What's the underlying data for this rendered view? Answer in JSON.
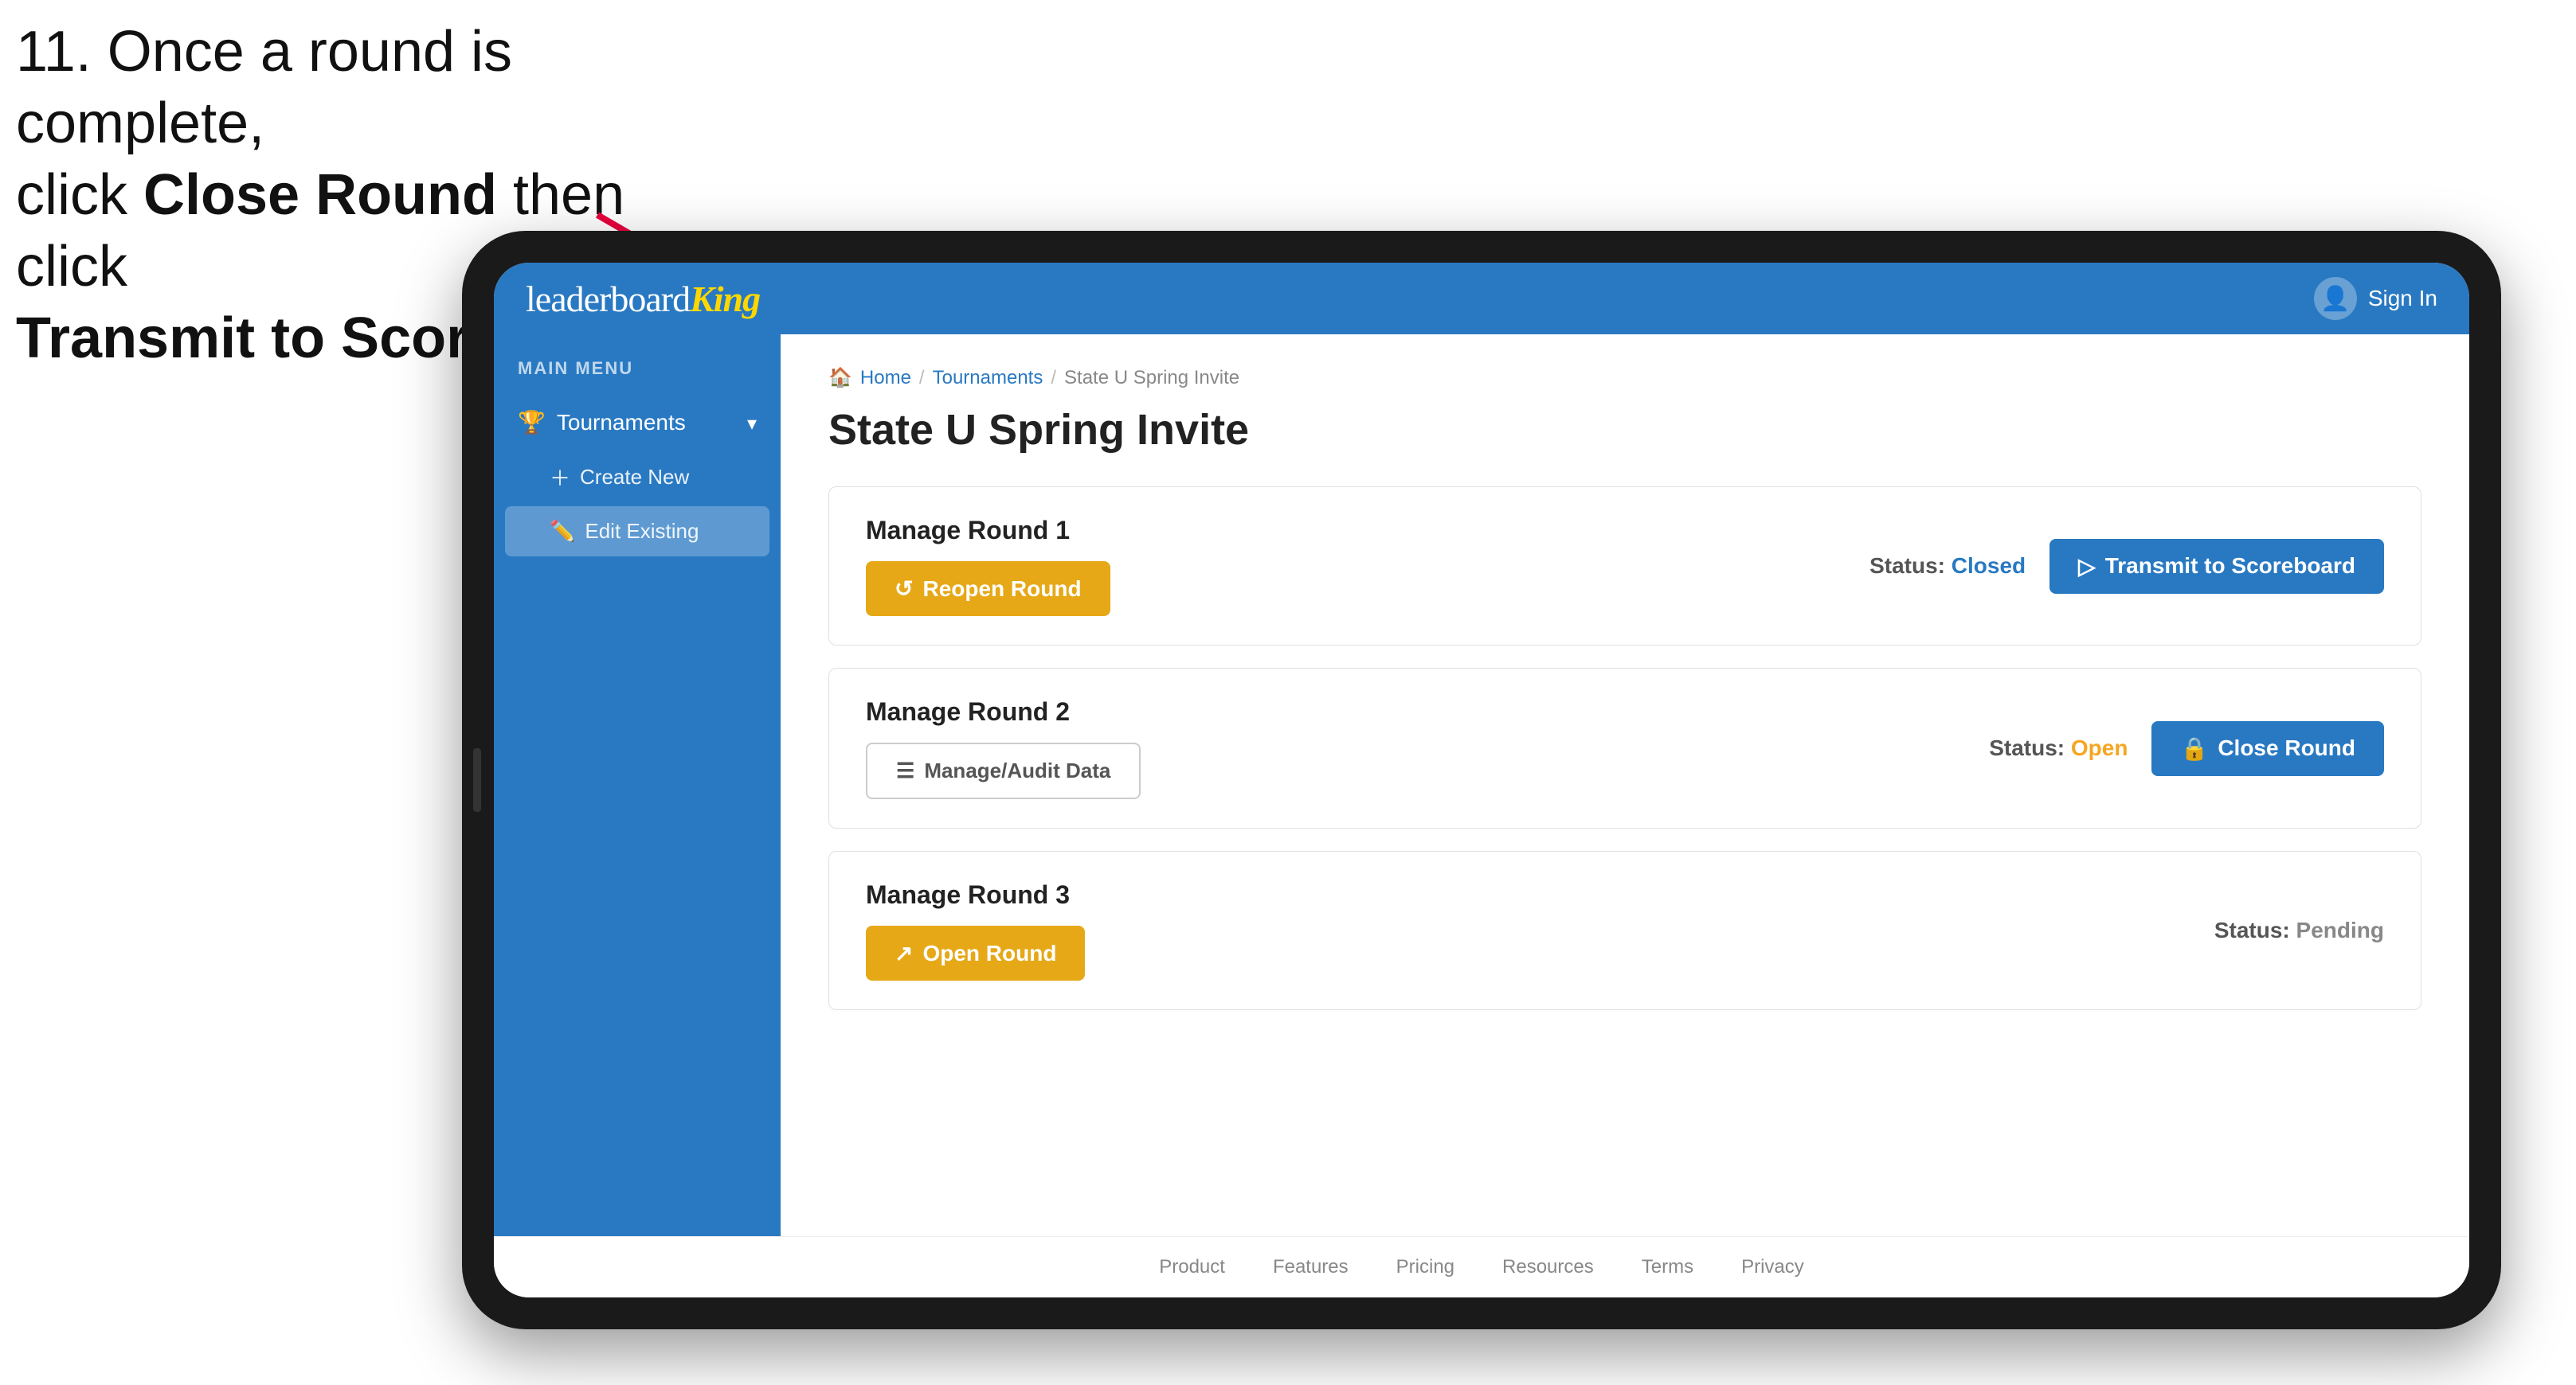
{
  "instruction": {
    "line1": "11. Once a round is complete,",
    "line2": "click ",
    "bold1": "Close Round",
    "line3": " then click",
    "bold2": "Transmit to Scoreboard."
  },
  "app": {
    "logo_leaderboard": "leaderboard",
    "logo_king": "King",
    "sign_in_label": "Sign In"
  },
  "sidebar": {
    "main_menu_label": "MAIN MENU",
    "items": [
      {
        "label": "Tournaments",
        "icon": "trophy",
        "has_submenu": true
      },
      {
        "label": "Create New",
        "icon": "plus",
        "sub": true
      },
      {
        "label": "Edit Existing",
        "icon": "edit",
        "sub": true,
        "active": true
      }
    ]
  },
  "breadcrumb": {
    "home": "Home",
    "tournaments": "Tournaments",
    "current": "State U Spring Invite"
  },
  "page": {
    "title": "State U Spring Invite"
  },
  "rounds": [
    {
      "id": "round1",
      "manage_label": "Manage Round 1",
      "status_label": "Status:",
      "status_value": "Closed",
      "status_class": "closed",
      "buttons": [
        {
          "label": "Reopen Round",
          "style": "gold",
          "icon": "↺"
        },
        {
          "label": "Transmit to Scoreboard",
          "style": "blue",
          "icon": "▷"
        }
      ]
    },
    {
      "id": "round2",
      "manage_label": "Manage Round 2",
      "status_label": "Status:",
      "status_value": "Open",
      "status_class": "open",
      "buttons": [
        {
          "label": "Manage/Audit Data",
          "style": "outline",
          "icon": "☰"
        },
        {
          "label": "Close Round",
          "style": "blue",
          "icon": "🔒"
        }
      ]
    },
    {
      "id": "round3",
      "manage_label": "Manage Round 3",
      "status_label": "Status:",
      "status_value": "Pending",
      "status_class": "pending",
      "buttons": [
        {
          "label": "Open Round",
          "style": "gold",
          "icon": "↗"
        }
      ]
    }
  ],
  "footer": {
    "links": [
      "Product",
      "Features",
      "Pricing",
      "Resources",
      "Terms",
      "Privacy"
    ]
  }
}
